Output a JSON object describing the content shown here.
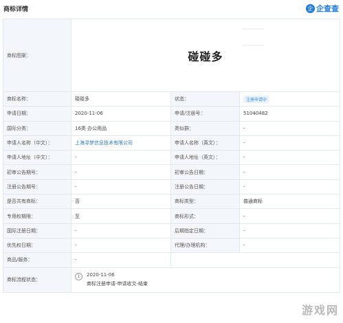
{
  "header": {
    "title": "商标详情",
    "brand_logo_char": "企",
    "brand_name": "企查查"
  },
  "logo_label": "商标图案：",
  "logo_text": "碰碰多",
  "rows": [
    [
      {
        "k": "商标名称：",
        "v": "碰碰多"
      },
      {
        "k": "状态：",
        "v": "注册申请中",
        "tag": true
      }
    ],
    [
      {
        "k": "申请日期：",
        "v": "2020-11-06"
      },
      {
        "k": "申请/注册号：",
        "v": "51040482"
      }
    ],
    [
      {
        "k": "国际分类：",
        "v": "16类 办公用品"
      },
      {
        "k": "类似群：",
        "v": "-"
      }
    ],
    [
      {
        "k": "申请人名称（中文）：",
        "v": "上海寻梦信息技术有限公司",
        "link": true
      },
      {
        "k": "申请人名称（英文）：",
        "v": "-"
      }
    ],
    [
      {
        "k": "申请人地址（中文）：",
        "v": "-"
      },
      {
        "k": "申请人地址（英文）：",
        "v": "-"
      }
    ],
    [
      {
        "k": "初审公告期号：",
        "v": "-"
      },
      {
        "k": "初审公告日期：",
        "v": "-"
      }
    ],
    [
      {
        "k": "注册公告期号：",
        "v": "-"
      },
      {
        "k": "注册公告日期：",
        "v": "-"
      }
    ],
    [
      {
        "k": "是否共有商标：",
        "v": "否"
      },
      {
        "k": "商标类型：",
        "v": "普通商标"
      }
    ],
    [
      {
        "k": "专用权期限：",
        "v": "至"
      },
      {
        "k": "商标形式：",
        "v": "-"
      }
    ],
    [
      {
        "k": "国际注册日期：",
        "v": "-"
      },
      {
        "k": "后期指定日期：",
        "v": "-"
      }
    ],
    [
      {
        "k": "优先权日期：",
        "v": "-"
      },
      {
        "k": "代理/办理机构：",
        "v": "-"
      }
    ]
  ],
  "goods_label": "商品/服务：",
  "goods_value": "-",
  "flow_label": "商标流程状态：",
  "flow_step_number": "1",
  "flow_date": "2020-11-06",
  "flow_desc": "商标注册申请-申请收文-结束",
  "watermark": "游戏网"
}
